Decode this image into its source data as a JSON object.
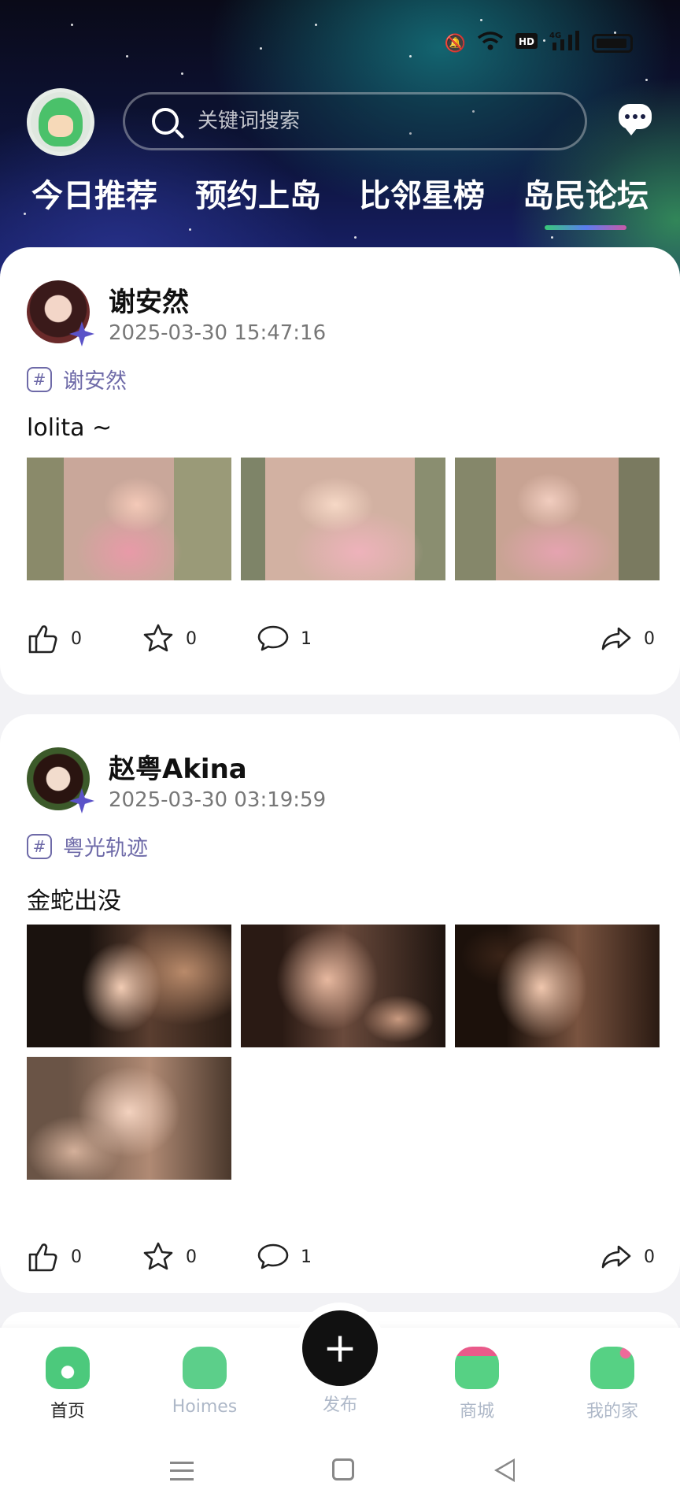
{
  "header": {
    "search_placeholder": "关键词搜索",
    "tabs": [
      {
        "label": "今日推荐"
      },
      {
        "label": "预约上岛"
      },
      {
        "label": "比邻星榜"
      },
      {
        "label": "岛民论坛"
      }
    ]
  },
  "posts": [
    {
      "user": "谢安然",
      "time": "2025-03-30 15:47:16",
      "topic": "谢安然",
      "text": "lolita ~",
      "likes": "0",
      "favorites": "0",
      "comments": "1",
      "shares": "0"
    },
    {
      "user": "赵粤Akina",
      "time": "2025-03-30 03:19:59",
      "topic": "粤光轨迹",
      "text": "金蛇出没",
      "likes": "0",
      "favorites": "0",
      "comments": "1",
      "shares": "0"
    }
  ],
  "nav": {
    "home": "首页",
    "hoimes": "Hoimes",
    "publish": "发布",
    "mall": "商城",
    "myhome": "我的家"
  },
  "colors": {
    "accent": "#6e6aa8",
    "verified": "#5a52c8",
    "tab_indicator": [
      "#38c878",
      "#5a7ef0",
      "#c85aa8"
    ]
  }
}
